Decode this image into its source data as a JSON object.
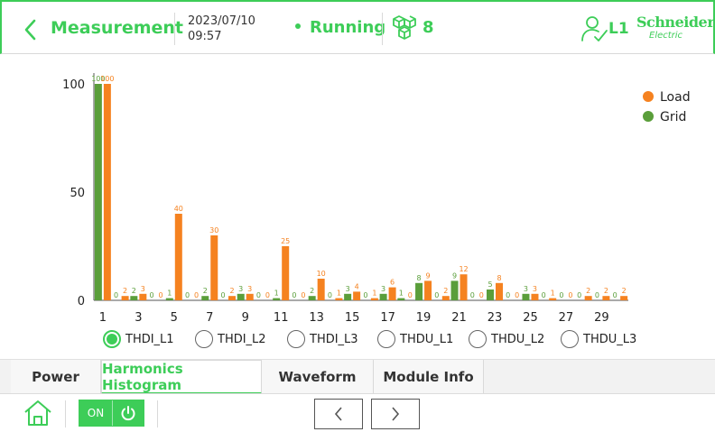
{
  "header": {
    "title": "Measurement",
    "date": "2023/07/10",
    "time": "09:57",
    "status": "Running",
    "cube_count": "8",
    "user_label": "L1",
    "logo_name": "Schneider",
    "logo_sub": "Electric"
  },
  "colors": {
    "accent": "#3dcd58",
    "load": "#f58220",
    "grid": "#5a9e3a"
  },
  "radios": [
    {
      "label": "THDI_L1",
      "selected": true
    },
    {
      "label": "THDI_L2",
      "selected": false
    },
    {
      "label": "THDI_L3",
      "selected": false
    },
    {
      "label": "THDU_L1",
      "selected": false
    },
    {
      "label": "THDU_L2",
      "selected": false
    },
    {
      "label": "THDU_L3",
      "selected": false
    }
  ],
  "tabs": [
    {
      "label": "Power",
      "active": false
    },
    {
      "label": "Harmonics Histogram",
      "active": true
    },
    {
      "label": "Waveform",
      "active": false
    },
    {
      "label": "Module Info",
      "active": false
    }
  ],
  "footer": {
    "on_label": "ON"
  },
  "chart_data": {
    "type": "bar",
    "categories": [
      "1",
      "2",
      "3",
      "4",
      "5",
      "6",
      "7",
      "8",
      "9",
      "10",
      "11",
      "12",
      "13",
      "14",
      "15",
      "16",
      "17",
      "18",
      "19",
      "20",
      "21",
      "22",
      "23",
      "24",
      "25",
      "26",
      "27",
      "28",
      "29",
      "30"
    ],
    "x_tick_labels": [
      "1",
      "3",
      "5",
      "7",
      "9",
      "11",
      "13",
      "15",
      "17",
      "19",
      "21",
      "23",
      "25",
      "27",
      "29"
    ],
    "series": [
      {
        "name": "Grid",
        "values": [
          100,
          0,
          2,
          0,
          1,
          0,
          2,
          0,
          3,
          0,
          1,
          0,
          2,
          0,
          3,
          0,
          3,
          1,
          8,
          0,
          9,
          0,
          5,
          0,
          3,
          0,
          0,
          0,
          0,
          0
        ]
      },
      {
        "name": "Load",
        "values": [
          100,
          2,
          3,
          0,
          40,
          0,
          30,
          2,
          3,
          0,
          25,
          0,
          10,
          1,
          4,
          1,
          6,
          0,
          9,
          2,
          12,
          0,
          8,
          0,
          3,
          1,
          0,
          2,
          2,
          2
        ]
      }
    ],
    "yticks": [
      0,
      50,
      100
    ],
    "ylim": [
      0,
      100
    ],
    "legend": "top-right",
    "xlabel": "",
    "ylabel": "",
    "title": ""
  }
}
